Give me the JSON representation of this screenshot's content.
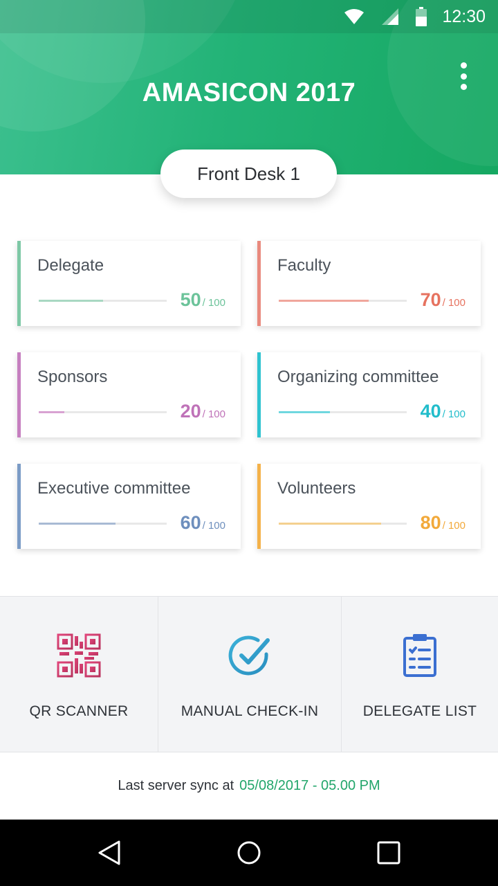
{
  "status_bar": {
    "time": "12:30",
    "icons": [
      "wifi-icon",
      "signal-icon",
      "battery-icon"
    ]
  },
  "header": {
    "title": "AMASICON 2017",
    "menu_icon": "more-vert-icon",
    "desk": "Front Desk 1"
  },
  "stats": [
    {
      "label": "Delegate",
      "value": "50",
      "total": "/ 100",
      "progress": 0.5,
      "color": "#7ec8a6",
      "bar_color": "#a8d8c2",
      "text_color": "#6cc39a"
    },
    {
      "label": "Faculty",
      "value": "70",
      "total": "/ 100",
      "progress": 0.7,
      "color": "#e98a7e",
      "bar_color": "#f0a69c",
      "text_color": "#e6725f"
    },
    {
      "label": "Sponsors",
      "value": "20",
      "total": "/ 100",
      "progress": 0.2,
      "color": "#c67fc0",
      "bar_color": "#d8a2d2",
      "text_color": "#bf72b8"
    },
    {
      "label": "Organizing committee",
      "value": "40",
      "total": "/ 100",
      "progress": 0.4,
      "color": "#2fc3d0",
      "bar_color": "#6fd7df",
      "text_color": "#22bdcb"
    },
    {
      "label": "Executive committee",
      "value": "60",
      "total": "/ 100",
      "progress": 0.6,
      "color": "#7b9bc6",
      "bar_color": "#a8bad4",
      "text_color": "#6e8fbd"
    },
    {
      "label": "Volunteers",
      "value": "80",
      "total": "/ 100",
      "progress": 0.8,
      "color": "#f4b24a",
      "bar_color": "#f4d08f",
      "text_color": "#f2a93a"
    }
  ],
  "actions": [
    {
      "label": "QR SCANNER",
      "icon": "qr-code-icon"
    },
    {
      "label": "MANUAL CHECK-IN",
      "icon": "check-circle-icon"
    },
    {
      "label": "DELEGATE LIST",
      "icon": "clipboard-list-icon"
    }
  ],
  "sync": {
    "label": "Last server sync at",
    "value": "05/08/2017 - 05.00 PM"
  },
  "navbar": {
    "icons": [
      "back-icon",
      "home-icon",
      "recents-icon"
    ]
  },
  "colors": {
    "accent": "#21a56a",
    "header_start": "#3cc08f",
    "header_end": "#16a862"
  }
}
